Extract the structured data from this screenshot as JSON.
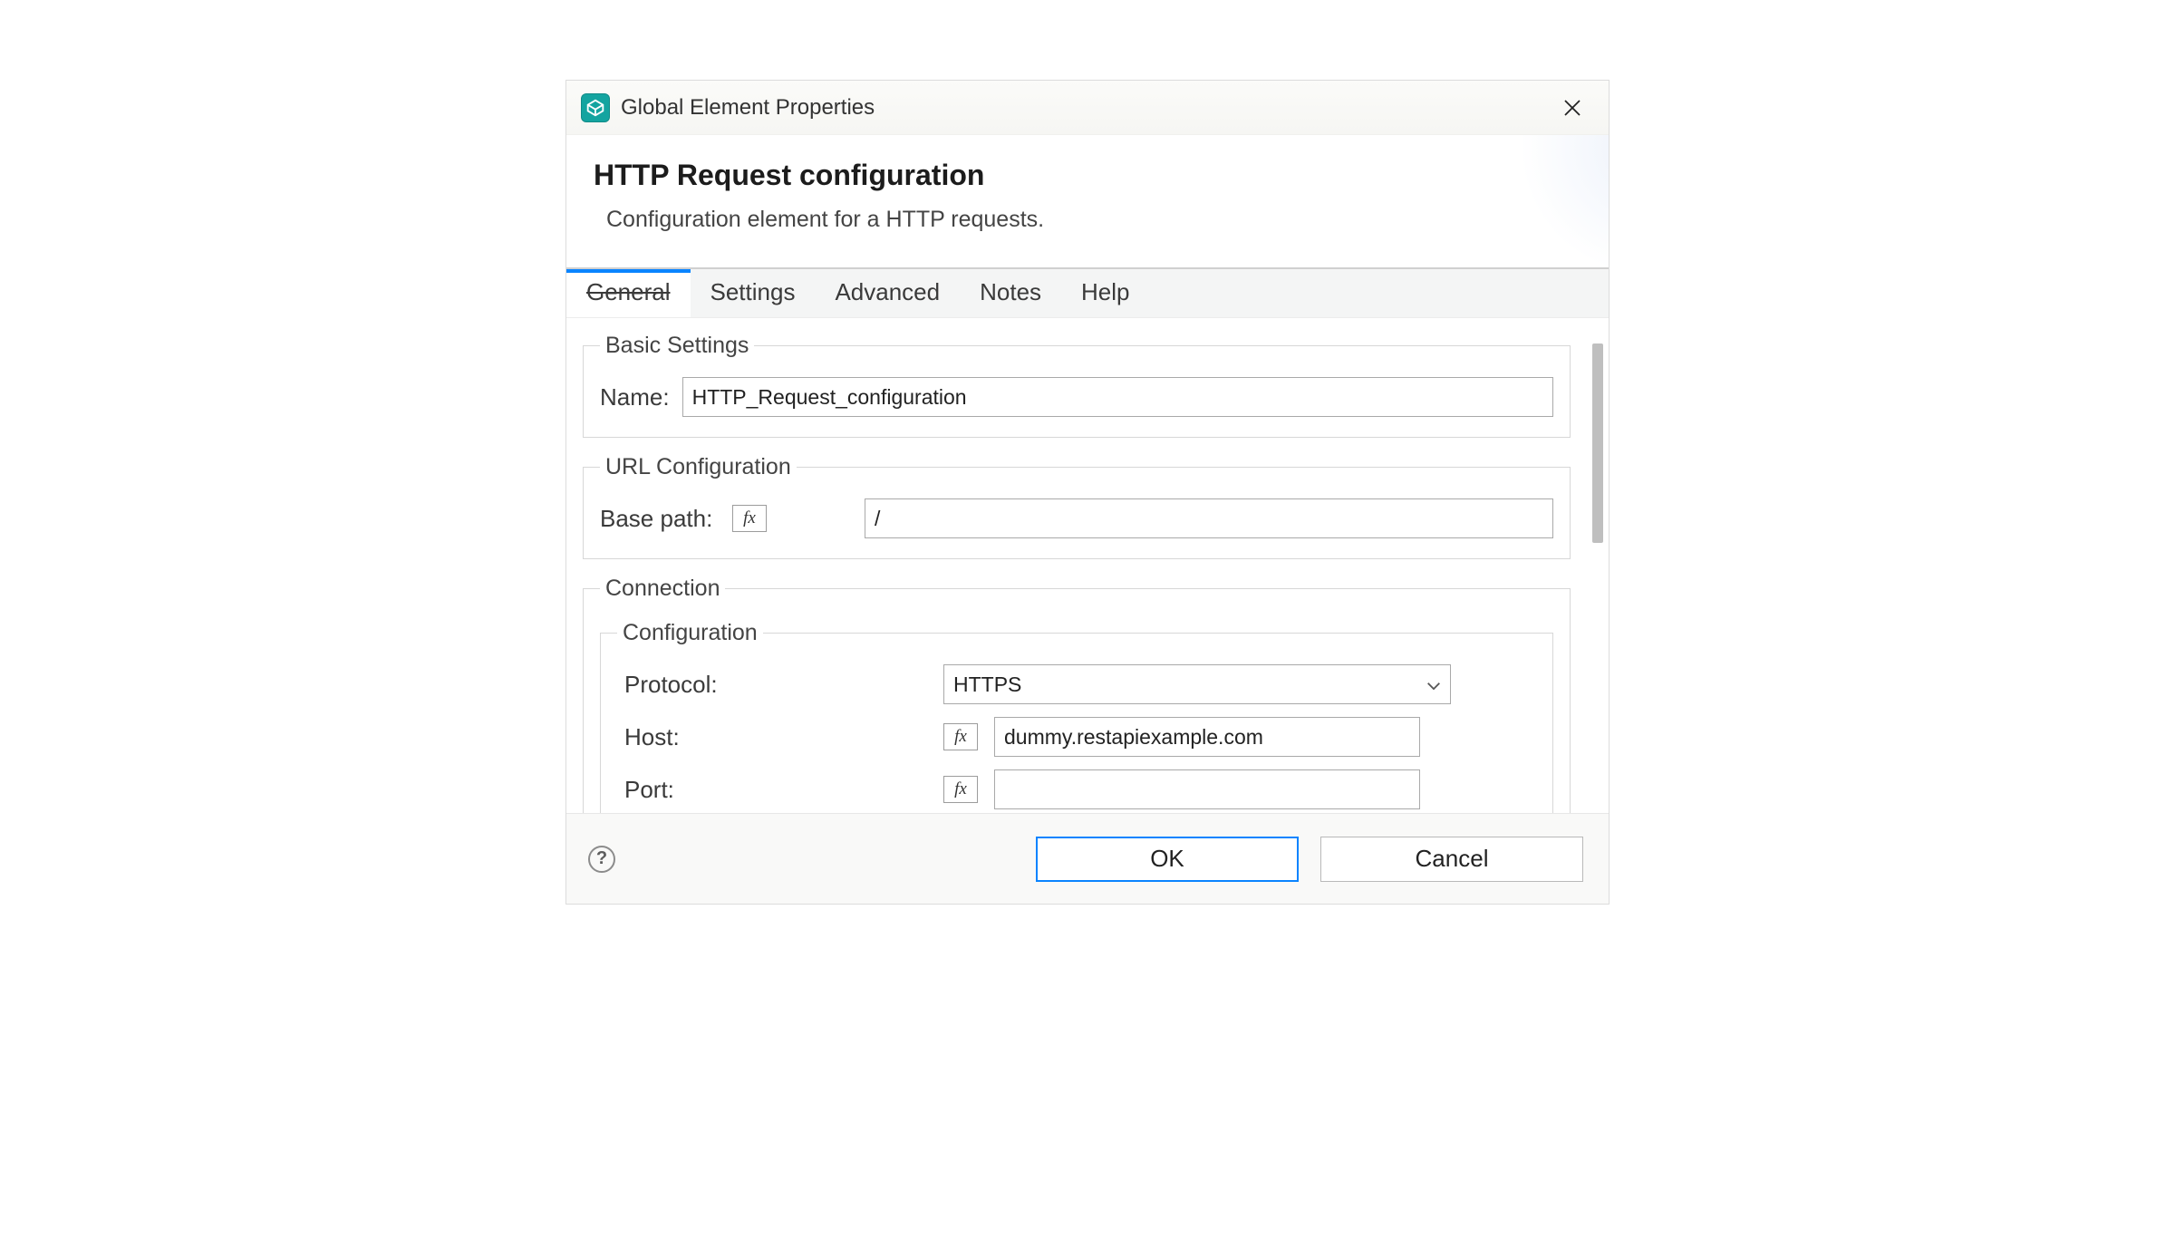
{
  "titlebar": {
    "title": "Global Element Properties"
  },
  "header": {
    "heading": "HTTP Request configuration",
    "subheading": "Configuration element for a HTTP requests."
  },
  "tabs": {
    "items": [
      "General",
      "Settings",
      "Advanced",
      "Notes",
      "Help"
    ],
    "active_index": 0
  },
  "basic": {
    "legend": "Basic Settings",
    "name_label": "Name:",
    "name_value": "HTTP_Request_configuration"
  },
  "url": {
    "legend": "URL Configuration",
    "basepath_label": "Base path:",
    "basepath_value": "/"
  },
  "connection": {
    "legend": "Connection",
    "config_legend": "Configuration",
    "protocol_label": "Protocol:",
    "protocol_value": "HTTPS",
    "host_label": "Host:",
    "host_value": "dummy.restapiexample.com",
    "port_label": "Port:",
    "port_value": ""
  },
  "footer": {
    "ok": "OK",
    "cancel": "Cancel"
  },
  "fx_label": "fx"
}
